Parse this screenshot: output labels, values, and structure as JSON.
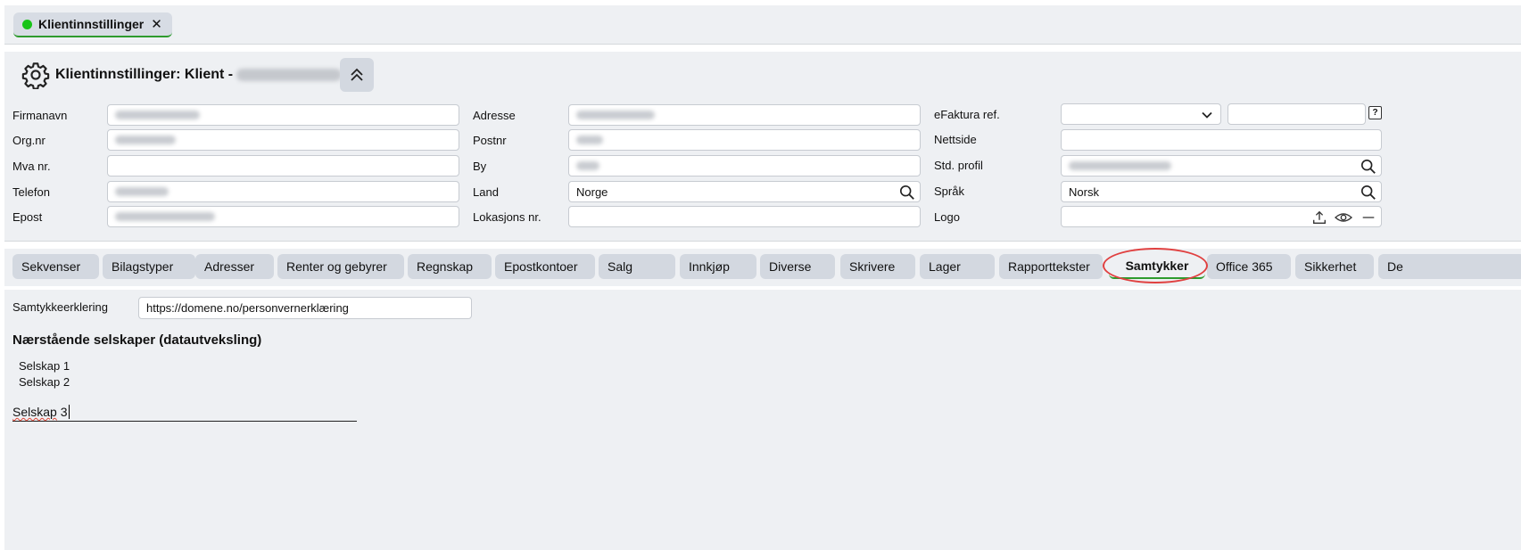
{
  "document_tab": {
    "label": "Klientinnstillinger",
    "close": "✕"
  },
  "header": {
    "title": "Klientinnstillinger: Klient -"
  },
  "fields_col1": {
    "firmanavn_label": "Firmanavn",
    "orgnr_label": "Org.nr",
    "mva_label": "Mva nr.",
    "mva_value": "",
    "telefon_label": "Telefon",
    "epost_label": "Epost"
  },
  "fields_col2": {
    "adresse_label": "Adresse",
    "postnr_label": "Postnr",
    "by_label": "By",
    "land_label": "Land",
    "land_value": "Norge",
    "lokasjon_label": "Lokasjons nr.",
    "lokasjon_value": ""
  },
  "fields_col3": {
    "efaktura_label": "eFaktura ref.",
    "efaktura_select_value": "",
    "efaktura_value": "",
    "help": "?",
    "nettside_label": "Nettside",
    "nettside_value": "",
    "profil_label": "Std. profil",
    "sprak_label": "Språk",
    "sprak_value": "Norsk",
    "logo_label": "Logo"
  },
  "tabs": [
    "Sekvenser",
    "Bilagstyper",
    "Adresser",
    "Renter og gebyrer",
    "Regnskap",
    "Epostkontoer",
    "Salg",
    "Innkjøp",
    "Diverse",
    "Skrivere",
    "Lager",
    "Rapporttekster",
    "Samtykker",
    "Office 365",
    "Sikkerhet",
    "De"
  ],
  "active_tab": "Samtykker",
  "consent": {
    "label": "Samtykkeerklering",
    "url": "https://domene.no/personvernerklæring"
  },
  "related": {
    "heading": "Nærstående selskaper (datautveksling)",
    "companies": [
      "Selskap 1",
      "Selskap 2"
    ],
    "new_word": "Selskap",
    "new_number": "3"
  },
  "colors": {
    "accent_green": "#2e9b2e",
    "status_dot": "#18c418",
    "highlight_red": "#e04040"
  }
}
